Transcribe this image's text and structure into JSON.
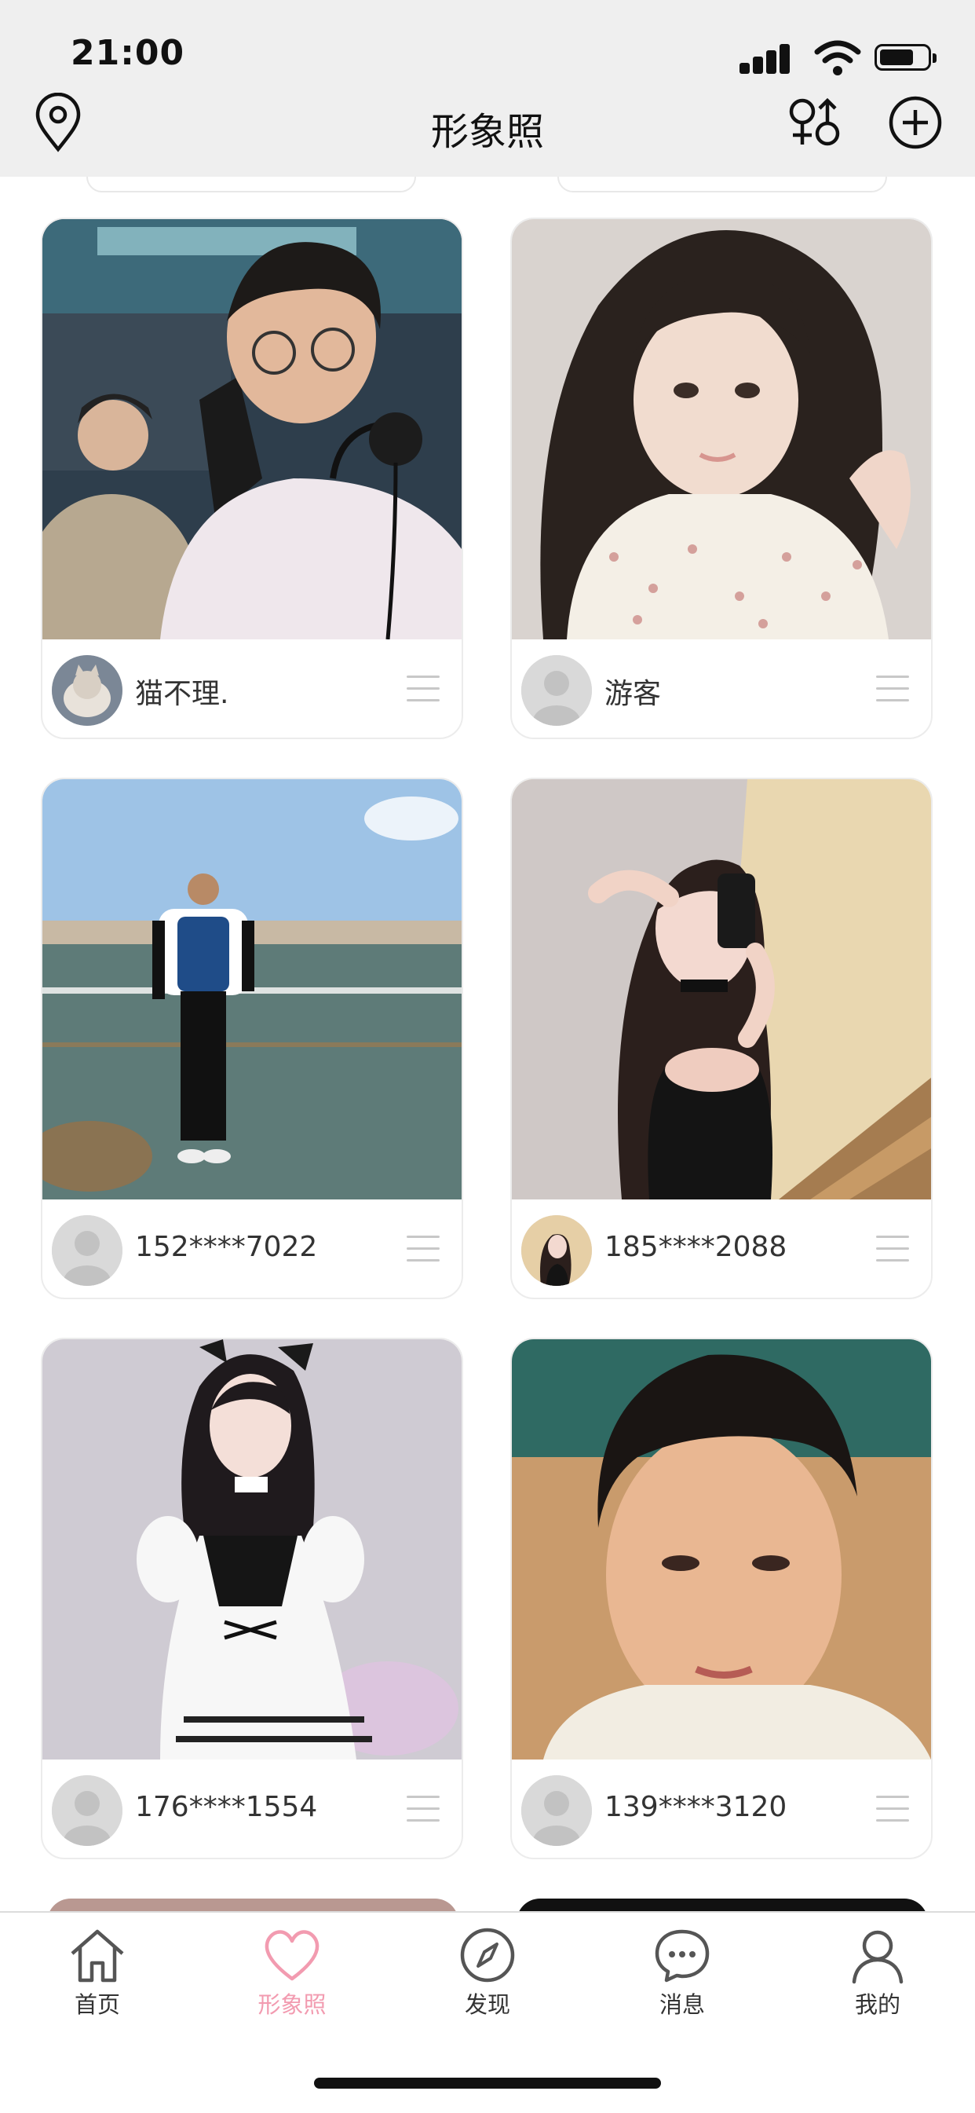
{
  "status_bar": {
    "time": "21:00"
  },
  "header": {
    "title": "形象照",
    "left_icon": "location-pin-icon",
    "right_icons": [
      "gender-filter-icon",
      "add-circle-icon"
    ]
  },
  "feed": {
    "cards": [
      {
        "username": "猫不理.",
        "avatar": "photo",
        "photo_desc": "gaming"
      },
      {
        "username": "游客",
        "avatar": "default",
        "photo_desc": "floral"
      },
      {
        "username": "152****7022",
        "avatar": "default",
        "photo_desc": "beach"
      },
      {
        "username": "185****2088",
        "avatar": "photo",
        "photo_desc": "selfie"
      },
      {
        "username": "176****1554",
        "avatar": "default",
        "photo_desc": "maid"
      },
      {
        "username": "139****3120",
        "avatar": "default",
        "photo_desc": "portrait"
      }
    ]
  },
  "tabbar": {
    "items": [
      {
        "label": "首页",
        "icon": "home-icon"
      },
      {
        "label": "形象照",
        "icon": "heart-icon",
        "active": true
      },
      {
        "label": "发现",
        "icon": "compass-icon"
      },
      {
        "label": "消息",
        "icon": "chat-icon"
      },
      {
        "label": "我的",
        "icon": "person-icon"
      }
    ]
  },
  "colors": {
    "accent": "#f29bb0",
    "header_bg": "#efefef",
    "text": "#111111"
  }
}
